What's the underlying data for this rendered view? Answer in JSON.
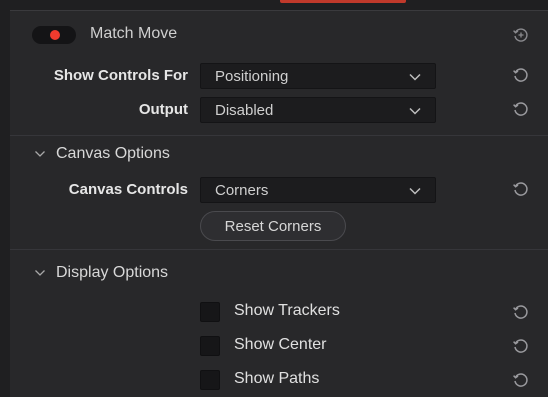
{
  "tool": {
    "title": "Match Move",
    "enabled": true
  },
  "fields": {
    "show_controls_for": {
      "label": "Show Controls For",
      "value": "Positioning"
    },
    "output": {
      "label": "Output",
      "value": "Disabled"
    },
    "canvas_controls": {
      "label": "Canvas Controls",
      "value": "Corners"
    }
  },
  "sections": {
    "canvas_options": "Canvas Options",
    "display_options": "Display Options"
  },
  "buttons": {
    "reset_corners": "Reset Corners"
  },
  "checkboxes": [
    {
      "label": "Show Trackers",
      "checked": false
    },
    {
      "label": "Show Center",
      "checked": false
    },
    {
      "label": "Show Paths",
      "checked": false
    }
  ],
  "colors": {
    "accent_red": "#ef3b2e",
    "panel_bg": "#28282a"
  },
  "icons": {
    "reset": "reset-icon",
    "dropdown": "chevron-down-icon",
    "section": "chevron-down-icon",
    "header_reset": "reset-plus-icon"
  }
}
